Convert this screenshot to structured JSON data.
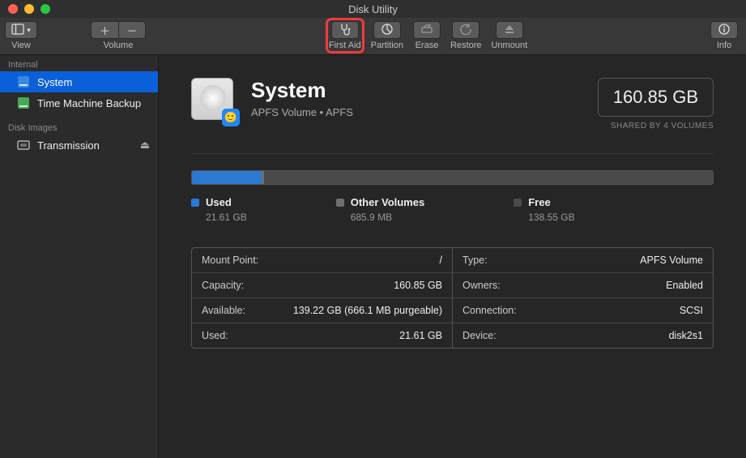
{
  "window": {
    "title": "Disk Utility"
  },
  "toolbar": {
    "view": "View",
    "volume": "Volume",
    "first_aid": "First Aid",
    "partition": "Partition",
    "erase": "Erase",
    "restore": "Restore",
    "unmount": "Unmount",
    "info": "Info"
  },
  "sidebar": {
    "sections": [
      {
        "header": "Internal",
        "items": [
          {
            "label": "System",
            "icon": "volume-icon",
            "selected": true
          },
          {
            "label": "Time Machine Backup",
            "icon": "volume-icon",
            "selected": false
          }
        ]
      },
      {
        "header": "Disk Images",
        "items": [
          {
            "label": "Transmission",
            "icon": "diskimage-icon",
            "ejectable": true
          }
        ]
      }
    ]
  },
  "volume": {
    "name": "System",
    "subtitle": "APFS Volume • APFS",
    "capacity": "160.85 GB",
    "shared_note": "SHARED BY 4 VOLUMES"
  },
  "usage": {
    "segments": [
      {
        "key": "used",
        "label": "Used",
        "value": "21.61 GB",
        "color": "#2a7ad4",
        "pct": 13.4
      },
      {
        "key": "other",
        "label": "Other Volumes",
        "value": "685.9 MB",
        "color": "#6f6f6f",
        "pct": 0.5
      },
      {
        "key": "free",
        "label": "Free",
        "value": "138.55 GB",
        "color": "#4a4a4a",
        "pct": 86.1
      }
    ]
  },
  "details": {
    "left": [
      {
        "k": "Mount Point:",
        "v": "/"
      },
      {
        "k": "Capacity:",
        "v": "160.85 GB"
      },
      {
        "k": "Available:",
        "v": "139.22 GB (666.1 MB purgeable)"
      },
      {
        "k": "Used:",
        "v": "21.61 GB"
      }
    ],
    "right": [
      {
        "k": "Type:",
        "v": "APFS Volume"
      },
      {
        "k": "Owners:",
        "v": "Enabled"
      },
      {
        "k": "Connection:",
        "v": "SCSI"
      },
      {
        "k": "Device:",
        "v": "disk2s1"
      }
    ]
  }
}
